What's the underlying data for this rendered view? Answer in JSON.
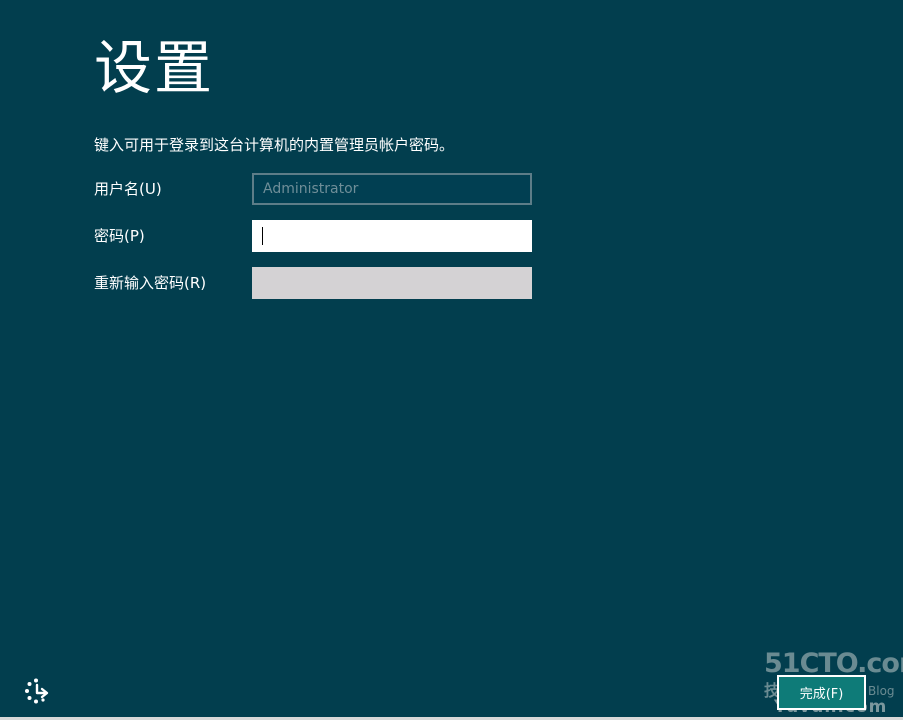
{
  "page": {
    "title": "设置",
    "instruction": "键入可用于登录到这台计算机的内置管理员帐户密码。"
  },
  "form": {
    "username": {
      "label": "用户名(U)",
      "placeholder": "Administrator"
    },
    "password": {
      "label": "密码(P)",
      "value": ""
    },
    "reenter_password": {
      "label": "重新输入密码(R)",
      "value": ""
    }
  },
  "footer": {
    "ease_of_access_icon": "ease-of-access-icon",
    "finish_label": "完成(F)"
  },
  "watermark": {
    "line1": "51CTO.com",
    "line2": "技术博客",
    "line2_suffix": "Blog",
    "line3": "Yuvuh.com"
  },
  "colors": {
    "background": "#023e4e",
    "finish_button": "#0e7b78",
    "disabled_field": "#d4d2d4"
  }
}
